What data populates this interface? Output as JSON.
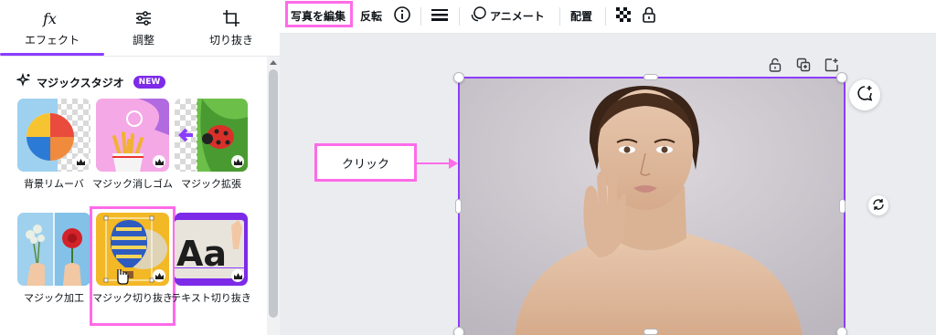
{
  "tabs": [
    {
      "label": "エフェクト",
      "icon": "fx-icon",
      "active": true
    },
    {
      "label": "調整",
      "icon": "sliders-icon",
      "active": false
    },
    {
      "label": "切り抜き",
      "icon": "crop-icon",
      "active": false
    }
  ],
  "section": {
    "title": "マジックスタジオ",
    "badge": "NEW",
    "icon": "sparkle-icon"
  },
  "tiles": [
    {
      "label": "背景リムーバ",
      "thumb": "beach-ball"
    },
    {
      "label": "マジック消しゴム",
      "thumb": "french-fries"
    },
    {
      "label": "マジック拡張",
      "thumb": "ladybug"
    },
    {
      "label": "マジック加工",
      "thumb": "flowers-hands"
    },
    {
      "label": "マジック切り抜き",
      "thumb": "hot-air-balloon",
      "highlighted": true
    },
    {
      "label": "テキスト切り抜き",
      "thumb": "text-aa"
    }
  ],
  "tile_thumb_text": "Aa",
  "toolbar": {
    "edit_photo": "写真を編集",
    "flip": "反転",
    "info_icon": "info-icon",
    "lines_icon": "lines-icon",
    "animate": "アニメート",
    "position": "配置",
    "transparency_icon": "checker-icon",
    "lock_icon": "lock-icon"
  },
  "canvas": {
    "callout": "クリック",
    "top_icons": [
      "lock-open-icon",
      "duplicate-icon",
      "add-page-icon"
    ],
    "comment_icon": "comment-plus-icon",
    "rotate_icon": "rotate-icon"
  },
  "colors": {
    "accent": "#8b3dff",
    "highlight": "#ff6be8",
    "badge": "#7d2ae8"
  }
}
